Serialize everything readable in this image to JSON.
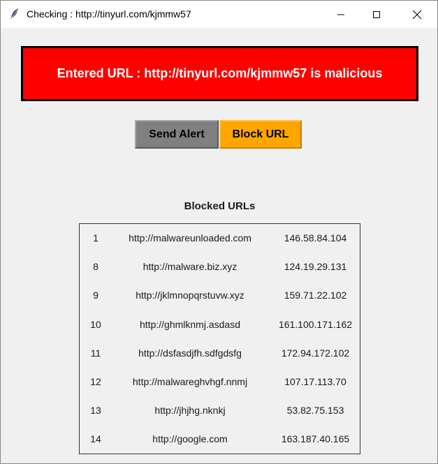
{
  "window": {
    "title": "Checking : http://tinyurl.com/kjmmw57",
    "icon": "feather-icon"
  },
  "banner": {
    "text": "Entered URL : http://tinyurl.com/kjmmw57 is malicious",
    "background": "#ff0000",
    "text_color": "#ffffff"
  },
  "actions": {
    "send_alert": "Send Alert",
    "block_url": "Block URL",
    "send_alert_color": "#808080",
    "block_url_color": "#ffa500"
  },
  "blocked": {
    "title": "Blocked URLs",
    "rows": [
      {
        "id": "1",
        "url": "http://malwareunloaded.com",
        "ip": "146.58.84.104"
      },
      {
        "id": "8",
        "url": "http://malware.biz.xyz",
        "ip": "124.19.29.131"
      },
      {
        "id": "9",
        "url": "http://jklmnopqrstuvw.xyz",
        "ip": "159.71.22.102"
      },
      {
        "id": "10",
        "url": "http://ghmlknmj.asdasd",
        "ip": "161.100.171.162"
      },
      {
        "id": "11",
        "url": "http://dsfasdjfh.sdfgdsfg",
        "ip": "172.94.172.102"
      },
      {
        "id": "12",
        "url": "http://malwareghvhgf.nnmj",
        "ip": "107.17.113.70"
      },
      {
        "id": "13",
        "url": "http://jhjhg.nknkj",
        "ip": "53.82.75.153"
      },
      {
        "id": "14",
        "url": "http://google.com",
        "ip": "163.187.40.165"
      }
    ]
  }
}
